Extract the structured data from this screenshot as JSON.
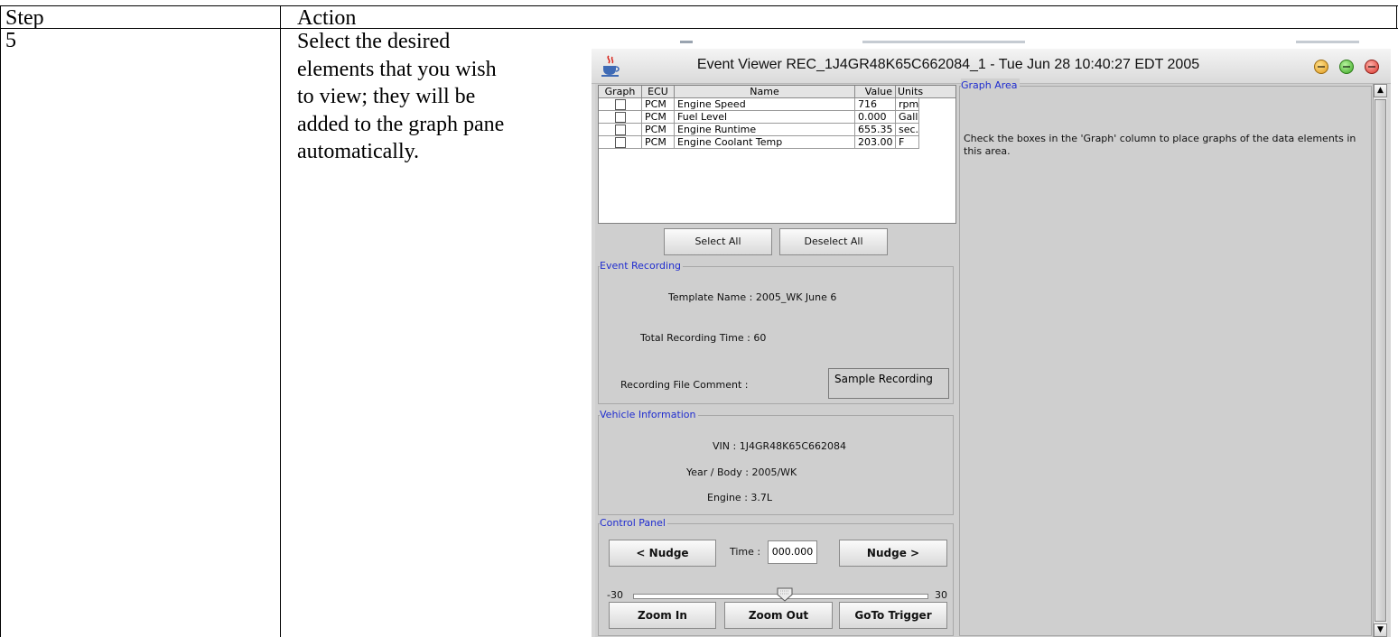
{
  "table": {
    "headers": {
      "step": "Step",
      "action": "Action"
    },
    "row": {
      "step": "5",
      "action_lines": [
        "Select the desired",
        "elements that you wish",
        "to view; they will be",
        "added to the graph pane",
        "automatically."
      ]
    }
  },
  "window": {
    "title": "Event Viewer REC_1J4GR48K65C662084_1 - Tue Jun 28 10:40:27 EDT 2005",
    "icon": "java-cup-icon",
    "controls": [
      "minimize-icon",
      "maximize-icon",
      "close-icon"
    ]
  },
  "grid": {
    "columns": [
      "Graph",
      "ECU",
      "Name",
      "Value",
      "Units"
    ],
    "rows": [
      {
        "ecu": "PCM",
        "name": "Engine Speed",
        "value": "716",
        "units": "rpm"
      },
      {
        "ecu": "PCM",
        "name": "Fuel Level",
        "value": "0.000",
        "units": "Gall..."
      },
      {
        "ecu": "PCM",
        "name": "Engine Runtime",
        "value": "655.35",
        "units": "sec..."
      },
      {
        "ecu": "PCM",
        "name": "Engine Coolant Temp",
        "value": "203.00",
        "units": "F"
      }
    ]
  },
  "buttons": {
    "select_all": "Select All",
    "deselect_all": "Deselect All"
  },
  "event_recording": {
    "title": "Event Recording",
    "template_name": "Template Name : 2005_WK June 6",
    "total_time": "Total Recording Time : 60",
    "comment_label": "Recording File Comment :",
    "comment_value": "Sample Recording"
  },
  "vehicle_info": {
    "title": "Vehicle Information",
    "vin": "VIN : 1J4GR48K65C662084",
    "year_body": "Year / Body : 2005/WK",
    "engine": "Engine : 3.7L"
  },
  "control_panel": {
    "title": "Control Panel",
    "nudge_back": "< Nudge",
    "time_label": "Time :",
    "time_value": "000.000",
    "nudge_forward": "Nudge >",
    "slider_min": "-30",
    "slider_max": "30",
    "zoom_in": "Zoom In",
    "zoom_out": "Zoom Out",
    "goto_trigger": "GoTo Trigger"
  },
  "graph_area": {
    "title": "Graph Area",
    "message": "Check the boxes in the 'Graph' column to place graphs of the data elements in this area."
  },
  "colors": {
    "group_title": "#1f2ccf",
    "window_bg": "#cfcfcf"
  }
}
